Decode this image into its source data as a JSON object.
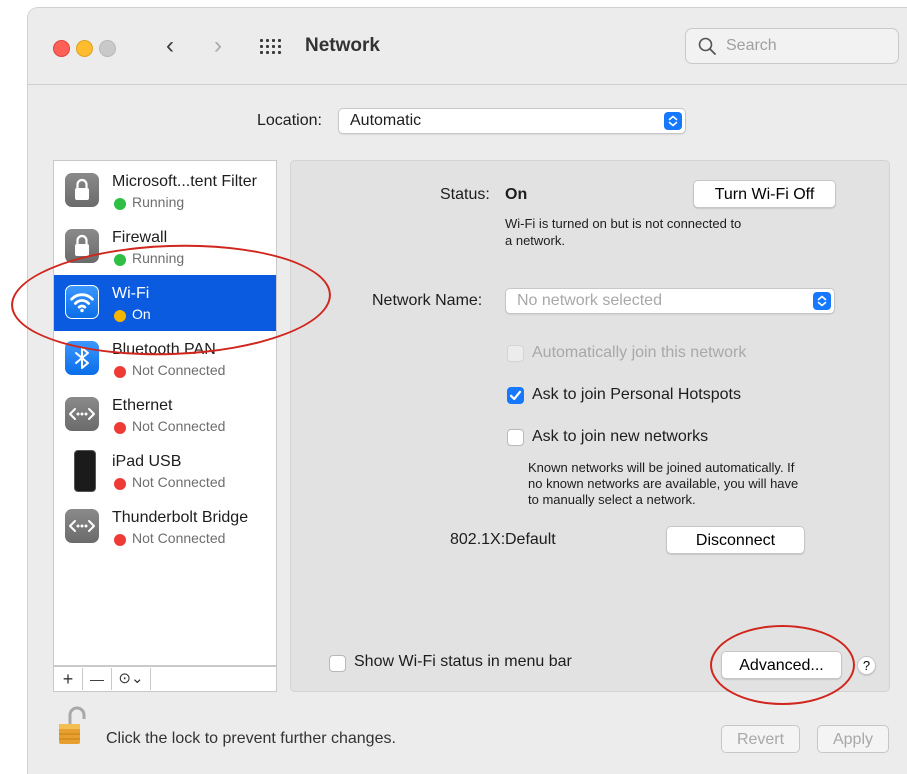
{
  "window": {
    "title": "Network",
    "search_placeholder": "Search",
    "nav_back": "‹",
    "nav_forward": "›"
  },
  "location": {
    "label": "Location:",
    "value": "Automatic"
  },
  "services": [
    {
      "name": "Microsoft...tent Filter",
      "status": "Running",
      "status_color": "#2dbe43",
      "icon": "lock-icon",
      "selected": false
    },
    {
      "name": "Firewall",
      "status": "Running",
      "status_color": "#2dbe43",
      "icon": "lock-icon",
      "selected": false
    },
    {
      "name": "Wi-Fi",
      "status": "On",
      "status_color": "#f5b400",
      "icon": "wifi-icon",
      "selected": true
    },
    {
      "name": "Bluetooth PAN",
      "status": "Not Connected",
      "status_color": "#ee3b35",
      "icon": "bluetooth-icon",
      "selected": false
    },
    {
      "name": "Ethernet",
      "status": "Not Connected",
      "status_color": "#ee3b35",
      "icon": "ethernet-icon",
      "selected": false
    },
    {
      "name": "iPad USB",
      "status": "Not Connected",
      "status_color": "#ee3b35",
      "icon": "ipad-icon",
      "selected": false
    },
    {
      "name": "Thunderbolt Bridge",
      "status": "Not Connected",
      "status_color": "#ee3b35",
      "icon": "ethernet-icon",
      "selected": false
    }
  ],
  "sidebar_tools": {
    "add": "+",
    "remove": "—",
    "action": "⊙⌄"
  },
  "detail": {
    "status_label": "Status:",
    "status_value": "On",
    "turn_off_button": "Turn Wi-Fi Off",
    "status_desc_line1": "Wi-Fi is turned on but is not connected to",
    "status_desc_line2": "a network.",
    "network_name_label": "Network Name:",
    "network_name_placeholder": "No network selected",
    "auto_join_label": "Automatically join this network",
    "auto_join_checked": false,
    "auto_join_enabled": false,
    "hotspots_label": "Ask to join Personal Hotspots",
    "hotspots_checked": true,
    "new_networks_label": "Ask to join new networks",
    "new_networks_checked": false,
    "new_networks_desc_line1": "Known networks will be joined automatically. If",
    "new_networks_desc_line2": "no known networks are available, you will have",
    "new_networks_desc_line3": "to manually select a network.",
    "dot1x_label": "802.1X:",
    "dot1x_value": "Default",
    "disconnect_button": "Disconnect",
    "show_status_label": "Show Wi-Fi status in menu bar",
    "show_status_checked": false,
    "advanced_button": "Advanced...",
    "help_button": "?"
  },
  "footer": {
    "lock_text": "Click the lock to prevent further changes.",
    "revert_button": "Revert",
    "apply_button": "Apply"
  },
  "colors": {
    "selection": "#0a5be0",
    "accent": "#1677ff",
    "annotation": "#d0261d"
  }
}
